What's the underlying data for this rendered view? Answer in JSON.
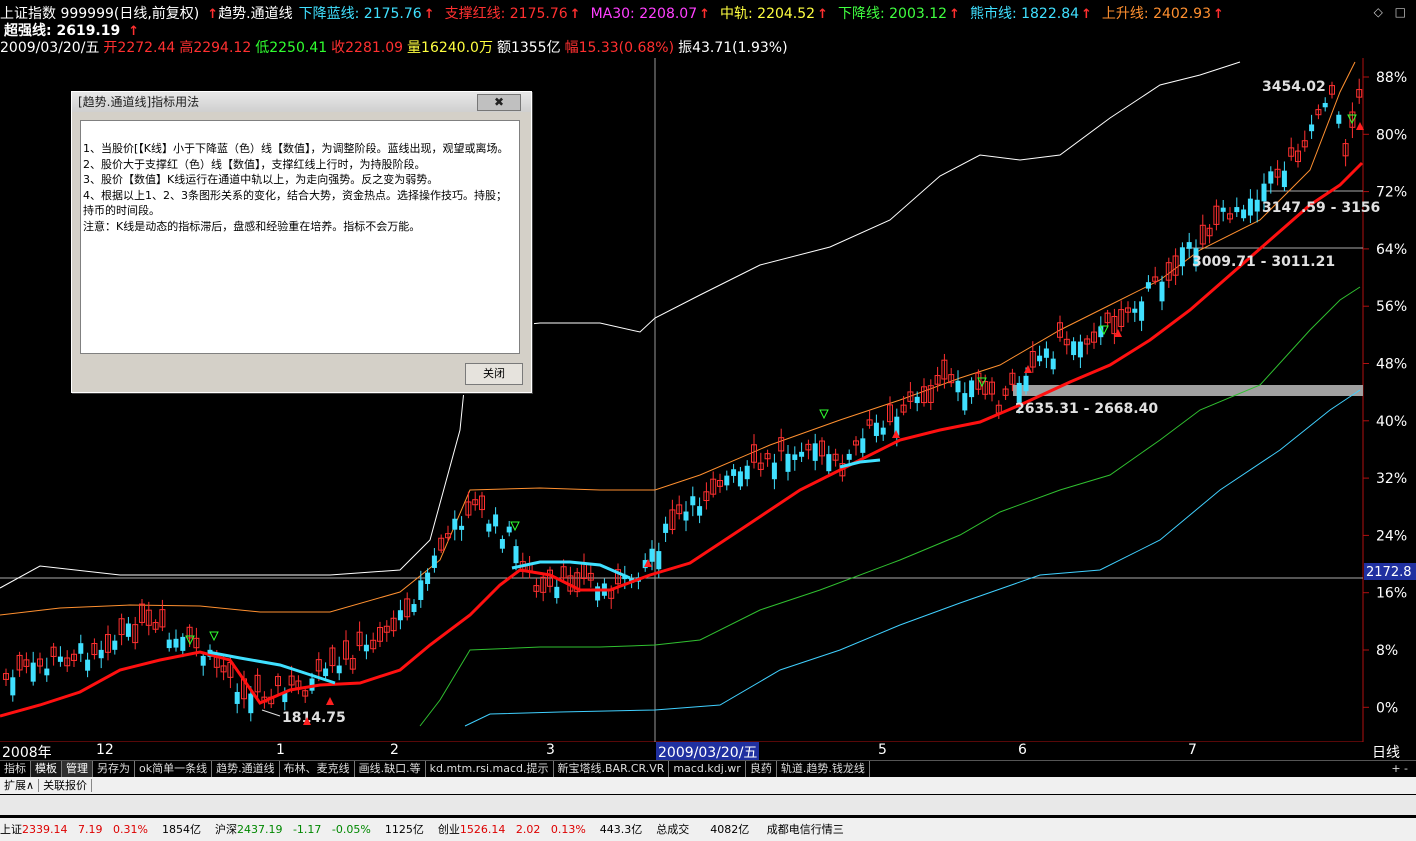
{
  "header": {
    "line1": [
      {
        "text": "上证指数 999999(日线,前复权)",
        "color": "#ffffff",
        "arrow": false
      },
      {
        "text": "趋势.通道线",
        "color": "#ffffff",
        "arrow_before": true
      },
      {
        "text": "下降蓝线: 2175.76",
        "color": "#40e0ff",
        "arrow": true
      },
      {
        "text": "支撑红线: 2175.76",
        "color": "#ff3030",
        "arrow": true
      },
      {
        "text": "MA30: 2208.07",
        "color": "#ff40ff",
        "arrow": true
      },
      {
        "text": "中轨: 2204.52",
        "color": "#ffff40",
        "arrow": true
      },
      {
        "text": "下降线: 2003.12",
        "color": "#40ff40",
        "arrow": true
      },
      {
        "text": "熊市线: 1822.84",
        "color": "#40e0ff",
        "arrow": true
      },
      {
        "text": "上升线: 2402.93",
        "color": "#ff9030",
        "arrow": true
      }
    ],
    "line2": {
      "text": "超强线: 2619.19",
      "color": "#ffffff"
    },
    "line3": [
      {
        "text": "2009/03/20/五",
        "color": "#ffffff"
      },
      {
        "text": "开2272.44",
        "color": "#ff3030"
      },
      {
        "text": "高2294.12",
        "color": "#ff3030"
      },
      {
        "text": "低2250.41",
        "color": "#30ff30"
      },
      {
        "text": "收2281.09",
        "color": "#ff3030"
      },
      {
        "text": "量16240.0万",
        "color": "#ffff40"
      },
      {
        "text": "额1355亿",
        "color": "#ffffff"
      },
      {
        "text": "幅15.33(0.68%)",
        "color": "#ff3030"
      },
      {
        "text": "振43.71(1.93%)",
        "color": "#ffffff"
      }
    ]
  },
  "chart_data": {
    "type": "candlestick",
    "y_axis_labels": [
      "88%",
      "80%",
      "72%",
      "64%",
      "56%",
      "48%",
      "40%",
      "32%",
      "24%",
      "16%",
      "8%",
      "0%"
    ],
    "price_marker": "2172.8",
    "x_labels": [
      "2008年",
      "12",
      "1",
      "2",
      "3",
      "2009/03/20/五",
      "5",
      "6",
      "7",
      "日线"
    ],
    "annotations": [
      "3454.02",
      "3147.59 - 3156",
      "3009.71 - 3011.21",
      "2635.31 - 2668.40",
      "1814.75"
    ],
    "colors": {
      "up": "#ff3030",
      "down": "#40e0ff",
      "support": "#ff1010",
      "upper": "#ffffff",
      "rising": "#ff9030",
      "falling": "#30c030",
      "bear": "#40d0ff"
    }
  },
  "dialog": {
    "title": "[趋势.通道线]指标用法",
    "close_x": "✖",
    "lines": [
      "1、当股价[【K线】小于下降蓝（色）线【数值】，为调整阶段。蓝线出现，观望或离场。",
      "2、股价大于支撑红（色）线【数值】，支撑红线上行时，为持股阶段。",
      "3、股价【数值】K线运行在通道中轨以上，为走向强势。反之变为弱势。",
      "4、根据以上1、2、3条图形关系的变化，结合大势，资金热点。选择操作技巧。持股；持币的时间段。",
      "注意：K线是动态的指标滞后，盘感和经验重在培养。指标不会万能。"
    ],
    "button": "关闭"
  },
  "tabs": [
    "指标",
    "模板",
    "管理",
    "另存为",
    "ok简单一条线",
    "趋势.通道线",
    "布林、麦克线",
    "画线.缺口.等",
    "kd.mtm.rsi.macd.提示",
    "新宝塔线.BAR.CR.VR",
    "macd.kdj.wr",
    "良药",
    "轨道.趋势.钱龙线"
  ],
  "tab_icons": "+  -",
  "subbar": [
    "扩展∧",
    "关联报价"
  ],
  "status": [
    {
      "label": "上证",
      "value": "2339.14",
      "chg": "7.19",
      "pct": "0.31%",
      "amt": "1854亿"
    },
    {
      "label": "沪深",
      "value": "2437.19",
      "chg": "-1.17",
      "pct": "-0.05%",
      "amt": "1125亿"
    },
    {
      "label": "创业",
      "value": "1526.14",
      "chg": "2.02",
      "pct": "0.13%",
      "amt": "443.3亿"
    }
  ],
  "status_total_label": "总成交",
  "status_total_value": "4082亿",
  "status_news": "成都电信行情三"
}
